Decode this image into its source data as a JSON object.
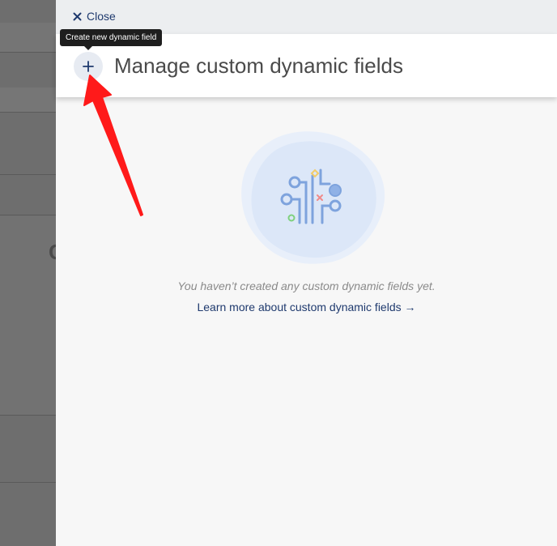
{
  "panel": {
    "close_label": "Close",
    "title": "Manage custom dynamic fields",
    "add_tooltip": "Create new dynamic field"
  },
  "empty_state": {
    "message": "You haven’t created any custom dynamic fields yet.",
    "link_label": "Learn more about custom dynamic fields",
    "link_arrow": "→"
  },
  "icons": {
    "close": "close-icon",
    "add": "plus-icon",
    "illustration": "circuit-illustration-icon",
    "annotation": "red-arrow-annotation"
  },
  "colors": {
    "accent": "#1f3a6e",
    "tooltip_bg": "#1e1e1e",
    "annotation": "#ff1a1a"
  }
}
